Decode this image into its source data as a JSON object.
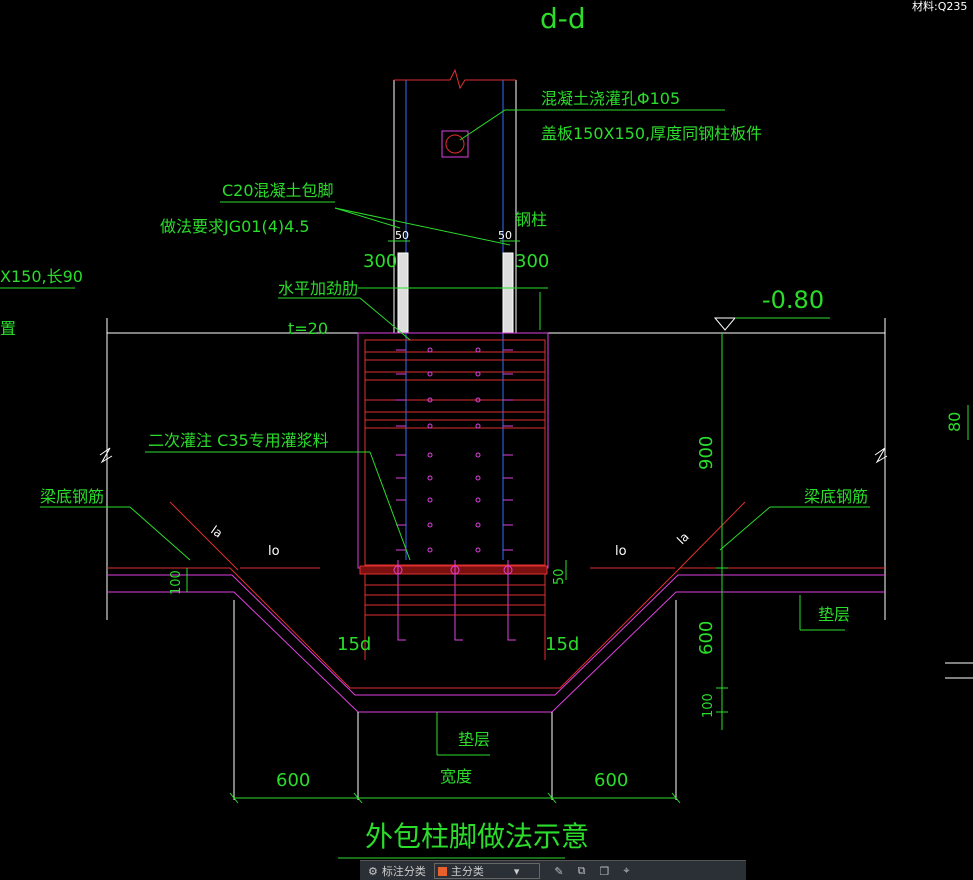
{
  "title_section": "d-d",
  "top_right_label": "材料:Q235",
  "labels": {
    "pour_hole": "混凝土浇灌孔Φ105",
    "cover_plate": "盖板150X150,厚度同钢柱板件",
    "c20_wrap": "C20混凝土包脚",
    "practice_req": "做法要求JG01(4)4.5",
    "steel_column": "钢柱",
    "left_size": "X150,长90",
    "left_char": "置",
    "horizontal_stiffener": "水平加劲肋",
    "plate_t": "t=20",
    "elevation": "-0.80",
    "grout": "二次灌注 C35专用灌浆料",
    "beam_rebar_left": "梁底钢筋",
    "beam_rebar_right": "梁底钢筋",
    "cushion_right": "垫层",
    "cushion_bottom": "垫层",
    "width": "宽度",
    "la_left": "la",
    "la_right": "la",
    "lo_left": "lo",
    "lo_right": "lo",
    "d15_left": "15d",
    "d15_right": "15d",
    "footer_title": "外包柱脚做法示意"
  },
  "dimensions": {
    "d50_left": "50",
    "d50_right": "50",
    "d300_left": "300",
    "d300_right": "300",
    "d900": "900",
    "d600_vert": "600",
    "d100_bottom": "100",
    "d100_left": "100",
    "d50_grout": "50",
    "d600_left": "600",
    "d600_right": "600",
    "d80_edge": "80"
  },
  "bottom_bar": {
    "item1": "标注分类",
    "item2": "主分类"
  },
  "colors": {
    "green": "#2bdc2b",
    "magenta": "#e040e0",
    "red": "#e03030",
    "white": "#ffffff",
    "blue": "#3a6dff"
  }
}
